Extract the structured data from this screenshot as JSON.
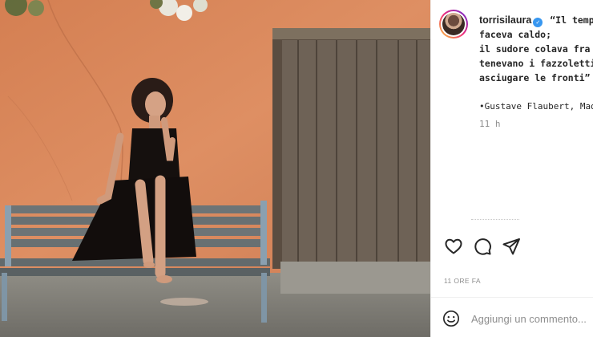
{
  "post": {
    "username": "torrisilaura",
    "verified_mark": "✓",
    "caption_lines": [
      "“Il tempo e",
      "faceva caldo;",
      "il sudore colava fra i ca",
      "tenevano i fazzoletti in",
      "asciugare le fronti”"
    ],
    "author": "•Gustave Flaubert,  Madam",
    "caption_time": "11 h",
    "time_ago": "11 ORE FA"
  },
  "actions": {
    "like_icon": "heart-icon",
    "comment_icon": "comment-icon",
    "share_icon": "share-icon"
  },
  "comment_box": {
    "emoji_icon": "emoji-icon",
    "placeholder": "Aggiungi un commento..."
  },
  "colors": {
    "wall": "#d98a5e",
    "door": "#6e5f52",
    "verified": "#3897f0",
    "muted": "#8e8e8e"
  }
}
